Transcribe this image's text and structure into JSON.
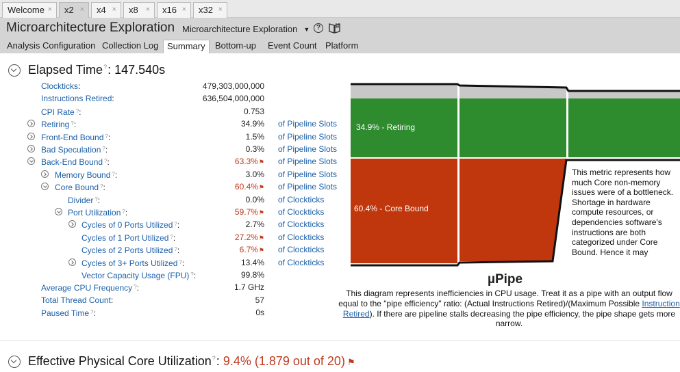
{
  "doc_tabs": [
    {
      "label": "Welcome",
      "active": false
    },
    {
      "label": "x2",
      "active": true
    },
    {
      "label": "x4",
      "active": false
    },
    {
      "label": "x8",
      "active": false
    },
    {
      "label": "x16",
      "active": false
    },
    {
      "label": "x32",
      "active": false
    }
  ],
  "tab_close_glyph": "×",
  "header": {
    "title": "Microarchitecture Exploration",
    "view_selector": "Microarchitecture Exploration",
    "icons": [
      "help-icon",
      "book-icon"
    ]
  },
  "nav_tabs": [
    {
      "label": "Analysis Configuration",
      "active": false
    },
    {
      "label": "Collection Log",
      "active": false
    },
    {
      "label": "Summary",
      "active": true
    },
    {
      "label": "Bottom-up",
      "active": false
    },
    {
      "label": "Event Count",
      "active": false
    },
    {
      "label": "Platform",
      "active": false
    }
  ],
  "elapsed": {
    "title": "Elapsed Time",
    "value": ": 147.540s"
  },
  "metrics": [
    {
      "label": "Clockticks",
      "help": false,
      "value": "479,303,000,000",
      "unit": "",
      "flag": false,
      "indent": 0,
      "expander": "none"
    },
    {
      "label": "Instructions Retired",
      "help": false,
      "value": "636,504,000,000",
      "unit": "",
      "flag": false,
      "indent": 0,
      "expander": "none"
    },
    {
      "label": "CPI Rate",
      "help": true,
      "value": "0.753",
      "unit": "",
      "flag": false,
      "indent": 0,
      "expander": "none"
    },
    {
      "label": "Retiring",
      "help": true,
      "value": "34.9%",
      "unit": "of Pipeline Slots",
      "flag": false,
      "indent": 0,
      "expander": "collapsed"
    },
    {
      "label": "Front-End Bound",
      "help": true,
      "value": "1.5%",
      "unit": "of Pipeline Slots",
      "flag": false,
      "indent": 0,
      "expander": "collapsed"
    },
    {
      "label": "Bad Speculation",
      "help": true,
      "value": "0.3%",
      "unit": "of Pipeline Slots",
      "flag": false,
      "indent": 0,
      "expander": "collapsed"
    },
    {
      "label": "Back-End Bound",
      "help": true,
      "value": "63.3%",
      "unit": "of Pipeline Slots",
      "flag": true,
      "indent": 0,
      "expander": "expanded"
    },
    {
      "label": "Memory Bound",
      "help": true,
      "value": "3.0%",
      "unit": "of Pipeline Slots",
      "flag": false,
      "indent": 1,
      "expander": "collapsed"
    },
    {
      "label": "Core Bound",
      "help": true,
      "value": "60.4%",
      "unit": "of Pipeline Slots",
      "flag": true,
      "indent": 1,
      "expander": "expanded"
    },
    {
      "label": "Divider",
      "help": true,
      "value": "0.0%",
      "unit": "of Clockticks",
      "flag": false,
      "indent": 2,
      "expander": "none"
    },
    {
      "label": "Port Utilization",
      "help": true,
      "value": "59.7%",
      "unit": "of Clockticks",
      "flag": true,
      "indent": 2,
      "expander": "expanded"
    },
    {
      "label": "Cycles of 0 Ports Utilized",
      "help": true,
      "value": "2.7%",
      "unit": "of Clockticks",
      "flag": false,
      "indent": 3,
      "expander": "collapsed"
    },
    {
      "label": "Cycles of 1 Port Utilized",
      "help": true,
      "value": "27.2%",
      "unit": "of Clockticks",
      "flag": true,
      "indent": 3,
      "expander": "none"
    },
    {
      "label": "Cycles of 2 Ports Utilized",
      "help": true,
      "value": "6.7%",
      "unit": "of Clockticks",
      "flag": true,
      "indent": 3,
      "expander": "none"
    },
    {
      "label": "Cycles of 3+ Ports Utilized",
      "help": true,
      "value": "13.4%",
      "unit": "of Clockticks",
      "flag": false,
      "indent": 3,
      "expander": "collapsed"
    },
    {
      "label": "Vector Capacity Usage (FPU)",
      "help": true,
      "value": "99.8%",
      "unit": "",
      "flag": false,
      "indent": 3,
      "expander": "none"
    },
    {
      "label": "Average CPU Frequency",
      "help": true,
      "value": "1.7 GHz",
      "unit": "",
      "flag": false,
      "indent": 0,
      "expander": "none"
    },
    {
      "label": "Total Thread Count",
      "help": false,
      "value": "57",
      "unit": "",
      "flag": false,
      "indent": 0,
      "expander": "none"
    },
    {
      "label": "Paused Time",
      "help": true,
      "value": "0s",
      "unit": "",
      "flag": false,
      "indent": 0,
      "expander": "none"
    }
  ],
  "pipe": {
    "retiring_label": "34.9% - Retiring",
    "core_bound_label": "60.4% - Core Bound",
    "retiring_fraction": 0.349,
    "core_bound_fraction": 0.604,
    "colors": {
      "retiring": "#2e8b2e",
      "core_bound": "#c1370d",
      "outline": "#111111",
      "header": "#c8c8c8"
    },
    "tooltip": "This metric represents how much Core non-memory issues were of a bottleneck. Shortage in hardware compute resources, or dependencies software's instructions are both categorized under Core Bound. Hence it may",
    "title": "µPipe",
    "description_before": "This diagram represents inefficiencies in CPU usage. Treat it as a pipe with an output flow equal to the \"pipe efficiency\" ratio: (Actual Instructions Retired)/(Maximum Possible ",
    "description_link": "Instruction Retired",
    "description_after": "). If there are pipeline stalls decreasing the pipe efficiency, the pipe shape gets more narrow."
  },
  "effective": {
    "title": "Effective Physical Core Utilization",
    "value": "9.4% (1.879 out of 20)"
  },
  "help_glyph": "?",
  "flag_glyph": "⚑"
}
